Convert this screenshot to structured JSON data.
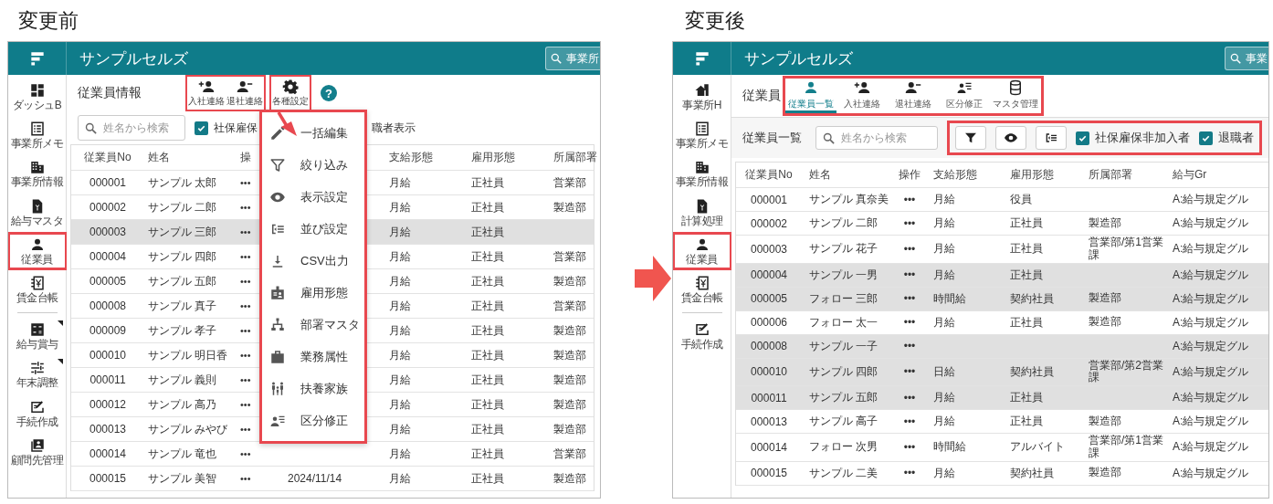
{
  "before": {
    "caption": "変更前",
    "app_title": "サンプルセルズ",
    "header_search": {
      "placeholder": "事業所"
    },
    "sidebar_groups": [
      [
        {
          "label": "ダッシュB",
          "highlighted": false,
          "has_submenu": false
        },
        {
          "label": "事業所メモ",
          "highlighted": false,
          "has_submenu": false
        },
        {
          "label": "事業所情報",
          "highlighted": false,
          "has_submenu": false
        },
        {
          "label": "給与マスタ",
          "highlighted": false,
          "has_submenu": false
        },
        {
          "label": "従業員",
          "highlighted": true,
          "has_submenu": false
        },
        {
          "label": "賃金台帳",
          "highlighted": false,
          "has_submenu": false
        }
      ],
      [
        {
          "label": "給与賞与",
          "highlighted": false,
          "has_submenu": true
        },
        {
          "label": "年末調整",
          "highlighted": false,
          "has_submenu": true
        },
        {
          "label": "手続作成",
          "highlighted": false,
          "has_submenu": false
        },
        {
          "label": "顧問先管理",
          "highlighted": false,
          "has_submenu": false
        }
      ]
    ],
    "page_title": "従業員情報",
    "toolbar_groups": [
      {
        "highlighted": true,
        "buttons": [
          {
            "label": "入社連絡"
          },
          {
            "label": "退社連絡"
          }
        ]
      },
      {
        "highlighted": true,
        "buttons": [
          {
            "label": "各種設定"
          }
        ]
      }
    ],
    "help_button": "?",
    "search": {
      "placeholder": "姓名から検索"
    },
    "checkbox": {
      "label": "社保雇保",
      "checked": true
    },
    "partial_label": "職者表示",
    "menu": {
      "highlighted": true,
      "items": [
        {
          "label": "一括編集"
        },
        {
          "label": "絞り込み"
        },
        {
          "label": "表示設定"
        },
        {
          "label": "並び設定"
        },
        {
          "label": "CSV出力"
        },
        {
          "label": "雇用形態"
        },
        {
          "label": "部署マスタ"
        },
        {
          "label": "業務属性"
        },
        {
          "label": "扶養家族"
        },
        {
          "label": "区分修正"
        }
      ]
    },
    "table": {
      "columns": [
        "従業員No",
        "姓名",
        "操",
        null,
        "支給形態",
        "雇用形態",
        "所属部署"
      ],
      "rows": [
        {
          "shaded": false,
          "cells": [
            "000001",
            "サンプル 太郎",
            "•••",
            null,
            "月給",
            "正社員",
            "営業部"
          ]
        },
        {
          "shaded": false,
          "cells": [
            "000002",
            "サンプル 二郎",
            "•••",
            null,
            "月給",
            "正社員",
            "製造部"
          ]
        },
        {
          "shaded": true,
          "cells": [
            "000003",
            "サンプル 三郎",
            "•••",
            null,
            "月給",
            "正社員",
            null
          ]
        },
        {
          "shaded": false,
          "cells": [
            "000004",
            "サンプル 四郎",
            "•••",
            null,
            "月給",
            "正社員",
            "営業部"
          ]
        },
        {
          "shaded": false,
          "cells": [
            "000005",
            "サンプル 五郎",
            "•••",
            null,
            "月給",
            "正社員",
            "製造部"
          ]
        },
        {
          "shaded": false,
          "cells": [
            "000008",
            "サンプル 真子",
            "•••",
            null,
            "月給",
            "正社員",
            "営業部"
          ]
        },
        {
          "shaded": false,
          "cells": [
            "000009",
            "サンプル 孝子",
            "•••",
            null,
            "月給",
            "正社員",
            "製造部"
          ]
        },
        {
          "shaded": false,
          "cells": [
            "000010",
            "サンプル 明日香",
            "•••",
            null,
            "月給",
            "正社員",
            "製造部"
          ]
        },
        {
          "shaded": false,
          "cells": [
            "000011",
            "サンプル 義則",
            "•••",
            null,
            "月給",
            "正社員",
            "製造部"
          ]
        },
        {
          "shaded": false,
          "cells": [
            "000012",
            "サンプル 高乃",
            "•••",
            null,
            "月給",
            "正社員",
            "製造部"
          ]
        },
        {
          "shaded": false,
          "cells": [
            "000013",
            "サンプル みやび",
            "•••",
            null,
            "月給",
            "正社員",
            "製造部"
          ]
        },
        {
          "shaded": false,
          "cells": [
            "000014",
            "サンプル 竜也",
            "•••",
            null,
            "月給",
            "正社員",
            "営業部"
          ]
        },
        {
          "shaded": false,
          "cells": [
            "000015",
            "サンプル 美智",
            "•••",
            "2024/11/14",
            "月給",
            "正社員",
            "製造部"
          ]
        }
      ]
    }
  },
  "after": {
    "caption": "変更後",
    "app_title": "サンプルセルズ",
    "header_search": {
      "placeholder": "事業"
    },
    "sidebar_groups": [
      [
        {
          "label": "事業所H",
          "highlighted": false,
          "has_submenu": false
        },
        {
          "label": "事業所メモ",
          "highlighted": false,
          "has_submenu": false
        },
        {
          "label": "事業所情報",
          "highlighted": false,
          "has_submenu": false
        },
        {
          "label": "計算処理",
          "highlighted": false,
          "has_submenu": false
        },
        {
          "label": "従業員",
          "highlighted": true,
          "has_submenu": false
        },
        {
          "label": "賃金台帳",
          "highlighted": false,
          "has_submenu": false
        }
      ],
      [
        {
          "label": "手続作成",
          "highlighted": false,
          "has_submenu": false
        }
      ]
    ],
    "page_title": "従業員",
    "tabs": {
      "highlighted": true,
      "items": [
        {
          "label": "従業員一覧",
          "selected": true
        },
        {
          "label": "入社連絡",
          "selected": false
        },
        {
          "label": "退社連絡",
          "selected": false
        },
        {
          "label": "区分修正",
          "selected": false
        },
        {
          "label": "マスタ管理",
          "selected": false
        }
      ]
    },
    "list_title": "従業員一覧",
    "search": {
      "placeholder": "姓名から検索"
    },
    "filters": {
      "highlighted": true,
      "checkboxes": [
        {
          "label": "社保雇保非加入者",
          "checked": true
        },
        {
          "label": "退職者",
          "checked": true
        }
      ]
    },
    "table": {
      "columns": [
        "従業員No",
        "姓名",
        "操作",
        "支給形態",
        "雇用形態",
        "所属部署",
        "給与Gr"
      ],
      "rows": [
        {
          "shaded": false,
          "cells": [
            "000001",
            "サンプル 真奈美",
            "•••",
            "月給",
            "役員",
            null,
            "A:給与規定グル"
          ]
        },
        {
          "shaded": false,
          "cells": [
            "000002",
            "サンプル 二郎",
            "•••",
            "月給",
            "正社員",
            "製造部",
            "A:給与規定グル"
          ]
        },
        {
          "shaded": false,
          "cells": [
            "000003",
            "サンプル 花子",
            "•••",
            "月給",
            "正社員",
            "営業部/第1営業課",
            "A:給与規定グル"
          ]
        },
        {
          "shaded": true,
          "cells": [
            "000004",
            "サンプル 一男",
            "•••",
            "月給",
            "正社員",
            null,
            "A:給与規定グル"
          ]
        },
        {
          "shaded": true,
          "cells": [
            "000005",
            "フォロー 三郎",
            "•••",
            "時間給",
            "契約社員",
            "製造部",
            "A:給与規定グル"
          ]
        },
        {
          "shaded": false,
          "cells": [
            "000006",
            "フォロー 太一",
            "•••",
            "月給",
            "正社員",
            "製造部",
            "A:給与規定グル"
          ]
        },
        {
          "shaded": true,
          "cells": [
            "000008",
            "サンプル 一子",
            "•••",
            null,
            null,
            null,
            "A:給与規定グル"
          ]
        },
        {
          "shaded": true,
          "cells": [
            "000010",
            "サンプル 四郎",
            "•••",
            "日給",
            "契約社員",
            "営業部/第2営業課",
            "A:給与規定グル"
          ]
        },
        {
          "shaded": true,
          "cells": [
            "000011",
            "サンプル 五郎",
            "•••",
            "月給",
            "正社員",
            null,
            "A:給与規定グル"
          ]
        },
        {
          "shaded": false,
          "cells": [
            "000013",
            "サンプル 高子",
            "•••",
            "月給",
            "正社員",
            "製造部",
            "A:給与規定グル"
          ]
        },
        {
          "shaded": false,
          "cells": [
            "000014",
            "フォロー 次男",
            "•••",
            "時間給",
            "アルバイト",
            "営業部/第1営業課",
            "A:給与規定グル"
          ]
        },
        {
          "shaded": false,
          "cells": [
            "000015",
            "サンプル 二美",
            "•••",
            "月給",
            "契約社員",
            "製造部",
            "A:給与規定グル"
          ]
        }
      ]
    }
  }
}
